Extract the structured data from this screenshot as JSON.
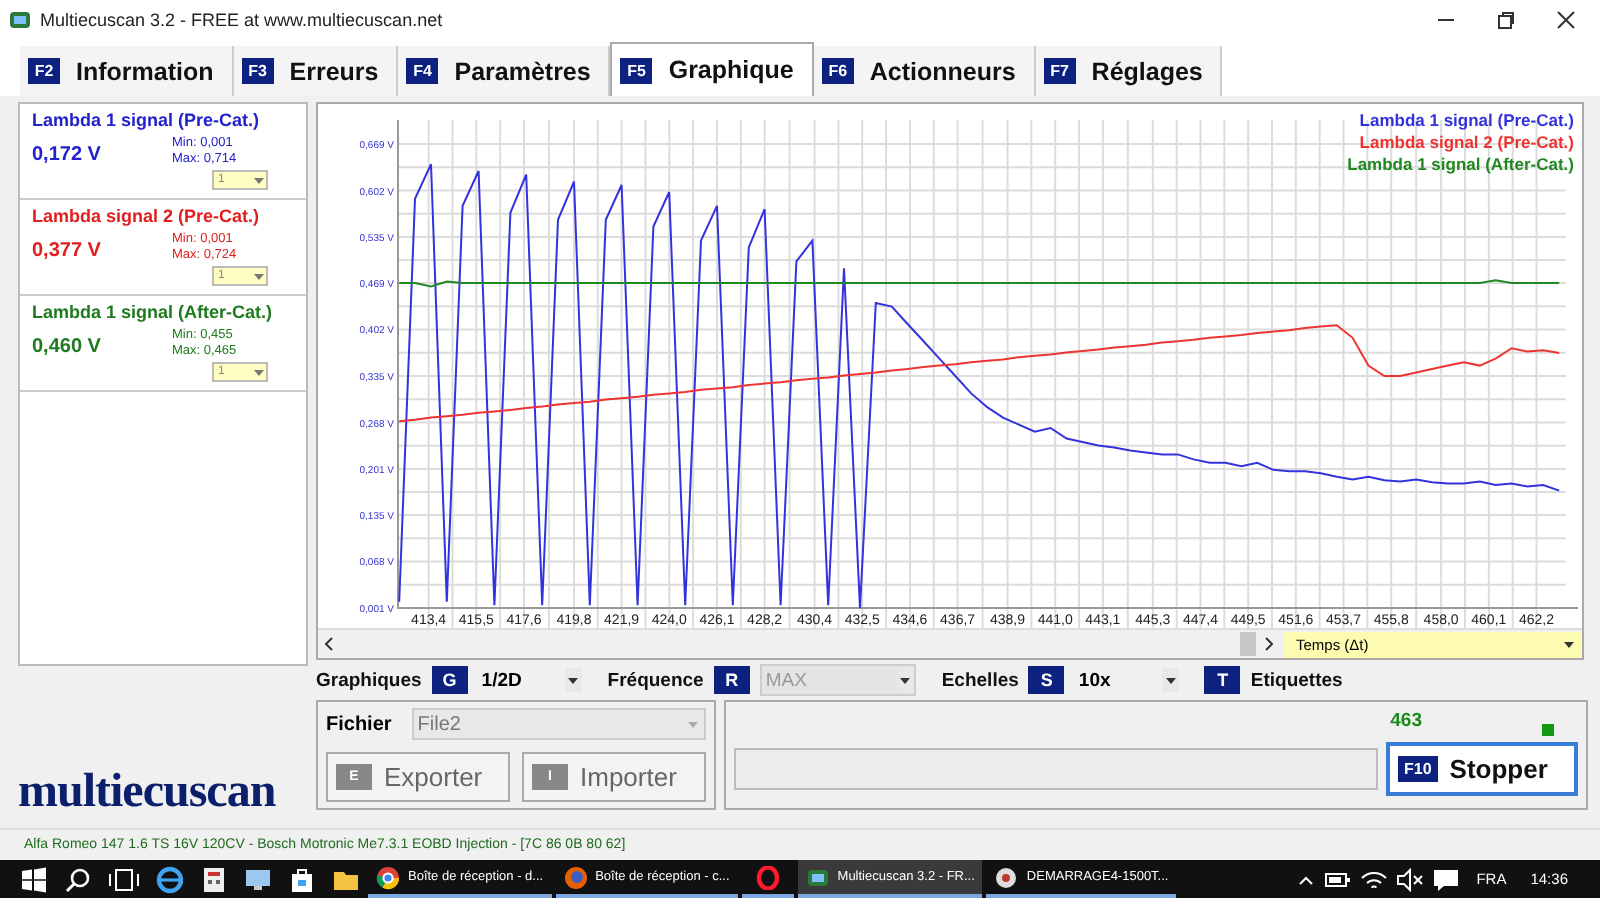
{
  "window": {
    "title": "Multiecuscan 3.2 - FREE at www.multiecuscan.net"
  },
  "tabs": [
    {
      "key": "F2",
      "label": "Information",
      "selected": false
    },
    {
      "key": "F3",
      "label": "Erreurs",
      "selected": false
    },
    {
      "key": "F4",
      "label": "Paramètres",
      "selected": false
    },
    {
      "key": "F5",
      "label": "Graphique",
      "selected": true
    },
    {
      "key": "F6",
      "label": "Actionneurs",
      "selected": false
    },
    {
      "key": "F7",
      "label": "Réglages",
      "selected": false
    }
  ],
  "signals": [
    {
      "name": "Lambda 1 signal (Pre-Cat.)",
      "value": "0,172 V",
      "min": "Min: 0,001",
      "max": "Max: 0,714",
      "scale": "1",
      "color": "#2222cc"
    },
    {
      "name": "Lambda signal 2 (Pre-Cat.)",
      "value": "0,377 V",
      "min": "Min: 0,001",
      "max": "Max: 0,724",
      "scale": "1",
      "color": "#e02020"
    },
    {
      "name": "Lambda 1 signal (After-Cat.)",
      "value": "0,460 V",
      "min": "Min: 0,455",
      "max": "Max: 0,465",
      "scale": "1",
      "color": "#1f7a1f"
    }
  ],
  "logo": "multiecuscan",
  "chart": {
    "axis_selector": "Temps (Δt)",
    "chart_data": {
      "type": "line",
      "x": [
        412.1,
        412.8,
        413.5,
        414.2,
        414.9,
        415.6,
        416.3,
        417.0,
        417.7,
        418.4,
        419.1,
        419.8,
        420.5,
        421.2,
        421.9,
        422.6,
        423.3,
        424.0,
        424.7,
        425.4,
        426.1,
        426.8,
        427.5,
        428.2,
        428.9,
        429.6,
        430.3,
        431.0,
        431.7,
        432.4,
        433.1,
        433.8,
        434.5,
        435.2,
        435.9,
        436.6,
        437.3,
        438.0,
        438.7,
        439.4,
        440.1,
        440.8,
        441.5,
        442.2,
        442.9,
        443.6,
        444.3,
        445.0,
        445.7,
        446.4,
        447.1,
        447.8,
        448.5,
        449.2,
        449.9,
        450.6,
        451.3,
        452.0,
        452.7,
        453.4,
        454.1,
        454.8,
        455.5,
        456.2,
        456.9,
        457.6,
        458.3,
        459.0,
        459.7,
        460.4,
        461.1,
        461.8,
        462.5,
        463.2
      ],
      "series": [
        {
          "name": "Lambda 1 signal (Pre-Cat.)",
          "color": "#3333dd",
          "values": [
            0.01,
            0.59,
            0.64,
            0.01,
            0.58,
            0.63,
            0.005,
            0.57,
            0.625,
            0.005,
            0.56,
            0.615,
            0.005,
            0.56,
            0.61,
            0.005,
            0.55,
            0.6,
            0.005,
            0.53,
            0.58,
            0.005,
            0.52,
            0.575,
            0.005,
            0.5,
            0.53,
            0.005,
            0.49,
            0.001,
            0.44,
            0.435,
            0.41,
            0.385,
            0.36,
            0.335,
            0.31,
            0.29,
            0.275,
            0.265,
            0.255,
            0.26,
            0.245,
            0.24,
            0.235,
            0.232,
            0.228,
            0.225,
            0.222,
            0.222,
            0.215,
            0.21,
            0.21,
            0.205,
            0.21,
            0.2,
            0.198,
            0.198,
            0.195,
            0.19,
            0.186,
            0.19,
            0.185,
            0.183,
            0.186,
            0.182,
            0.18,
            0.18,
            0.183,
            0.178,
            0.18,
            0.176,
            0.178,
            0.17
          ]
        },
        {
          "name": "Lambda signal 2 (Pre-Cat.)",
          "color": "#ee3333",
          "values": [
            0.27,
            0.272,
            0.275,
            0.277,
            0.279,
            0.282,
            0.284,
            0.286,
            0.289,
            0.291,
            0.294,
            0.296,
            0.298,
            0.301,
            0.303,
            0.305,
            0.308,
            0.31,
            0.312,
            0.315,
            0.317,
            0.319,
            0.322,
            0.324,
            0.326,
            0.329,
            0.331,
            0.333,
            0.336,
            0.338,
            0.34,
            0.343,
            0.345,
            0.348,
            0.35,
            0.352,
            0.355,
            0.357,
            0.359,
            0.362,
            0.364,
            0.366,
            0.369,
            0.371,
            0.373,
            0.376,
            0.378,
            0.38,
            0.383,
            0.385,
            0.387,
            0.39,
            0.392,
            0.394,
            0.397,
            0.399,
            0.401,
            0.404,
            0.406,
            0.408,
            0.39,
            0.35,
            0.335,
            0.335,
            0.34,
            0.345,
            0.35,
            0.355,
            0.35,
            0.36,
            0.375,
            0.37,
            0.372,
            0.368
          ]
        },
        {
          "name": "Lambda 1 signal (After-Cat.)",
          "color": "#228822",
          "values": [
            0.469,
            0.469,
            0.464,
            0.471,
            0.469,
            0.469,
            0.469,
            0.469,
            0.469,
            0.469,
            0.469,
            0.469,
            0.469,
            0.469,
            0.469,
            0.469,
            0.469,
            0.469,
            0.469,
            0.469,
            0.469,
            0.469,
            0.469,
            0.469,
            0.469,
            0.469,
            0.469,
            0.469,
            0.469,
            0.469,
            0.469,
            0.469,
            0.469,
            0.469,
            0.469,
            0.469,
            0.469,
            0.469,
            0.469,
            0.469,
            0.469,
            0.469,
            0.469,
            0.469,
            0.469,
            0.469,
            0.469,
            0.469,
            0.469,
            0.469,
            0.469,
            0.469,
            0.469,
            0.469,
            0.469,
            0.469,
            0.469,
            0.469,
            0.469,
            0.469,
            0.469,
            0.469,
            0.469,
            0.469,
            0.469,
            0.469,
            0.469,
            0.469,
            0.469,
            0.473,
            0.469,
            0.469,
            0.469,
            0.469
          ]
        }
      ],
      "grid": true,
      "xlim": [
        412.05,
        463.5
      ],
      "ylim": [
        0.001,
        0.669
      ],
      "xticks": [
        {
          "value": 413.4,
          "label": "413,4"
        },
        {
          "value": 415.5,
          "label": "415,5"
        },
        {
          "value": 417.6,
          "label": "417,6"
        },
        {
          "value": 419.8,
          "label": "419,8"
        },
        {
          "value": 421.9,
          "label": "421,9"
        },
        {
          "value": 424.0,
          "label": "424,0"
        },
        {
          "value": 426.1,
          "label": "426,1"
        },
        {
          "value": 428.2,
          "label": "428,2"
        },
        {
          "value": 430.4,
          "label": "430,4"
        },
        {
          "value": 432.5,
          "label": "432,5"
        },
        {
          "value": 434.6,
          "label": "434,6"
        },
        {
          "value": 436.7,
          "label": "436,7"
        },
        {
          "value": 438.9,
          "label": "438,9"
        },
        {
          "value": 441.0,
          "label": "441,0"
        },
        {
          "value": 443.1,
          "label": "443,1"
        },
        {
          "value": 445.3,
          "label": "445,3"
        },
        {
          "value": 447.4,
          "label": "447,4"
        },
        {
          "value": 449.5,
          "label": "449,5"
        },
        {
          "value": 451.6,
          "label": "451,6"
        },
        {
          "value": 453.7,
          "label": "453,7"
        },
        {
          "value": 455.8,
          "label": "455,8"
        },
        {
          "value": 458.0,
          "label": "458,0"
        },
        {
          "value": 460.1,
          "label": "460,1"
        },
        {
          "value": 462.2,
          "label": "462,2"
        }
      ],
      "yticks": [
        {
          "value": 0.001,
          "label": "0,001 V"
        },
        {
          "value": 0.068,
          "label": "0,068 V"
        },
        {
          "value": 0.135,
          "label": "0,135 V"
        },
        {
          "value": 0.201,
          "label": "0,201 V"
        },
        {
          "value": 0.268,
          "label": "0,268 V"
        },
        {
          "value": 0.335,
          "label": "0,335 V"
        },
        {
          "value": 0.402,
          "label": "0,402 V"
        },
        {
          "value": 0.469,
          "label": "0,469 V"
        },
        {
          "value": 0.535,
          "label": "0,535 V"
        },
        {
          "value": 0.602,
          "label": "0,602 V"
        },
        {
          "value": 0.669,
          "label": "0,669 V"
        }
      ]
    }
  },
  "options": [
    {
      "kind": "select",
      "label": "Graphiques",
      "key": "G",
      "value": "1/2D",
      "disabled": false
    },
    {
      "kind": "select",
      "label": "Fréquence",
      "key": "R",
      "value": "MAX",
      "disabled": true
    },
    {
      "kind": "select",
      "label": "Echelles",
      "key": "S",
      "value": "10x",
      "disabled": false
    },
    {
      "kind": "toggle",
      "key": "T",
      "label": "Etiquettes"
    }
  ],
  "file": {
    "label": "Fichier",
    "value": "File2",
    "buttons": [
      {
        "key": "E",
        "label": "Exporter",
        "disabled": true
      },
      {
        "key": "I",
        "label": "Importer",
        "disabled": true
      }
    ]
  },
  "recording": {
    "count": "463",
    "running": true,
    "level": 0,
    "button": {
      "key": "F10",
      "label": "Stopper"
    }
  },
  "status_bar": "Alfa Romeo 147 1.6 TS 16V 120CV - Bosch Motronic Me7.3.1 EOBD Injection - [7C 86 0B 80 62]",
  "taskbar": {
    "tasks": [
      {
        "kind": "chrome",
        "label": "Boîte de réception - d...",
        "active": false
      },
      {
        "kind": "firefox",
        "label": "Boîte de réception - c...",
        "active": false
      },
      {
        "kind": "opera",
        "active": false
      },
      {
        "kind": "app",
        "label": "Multiecuscan 3.2 - FR...",
        "active": true
      },
      {
        "kind": "doc",
        "label": "DEMARRAGE4-1500T...",
        "active": false
      }
    ],
    "language": "FRA",
    "time": "14:36"
  }
}
